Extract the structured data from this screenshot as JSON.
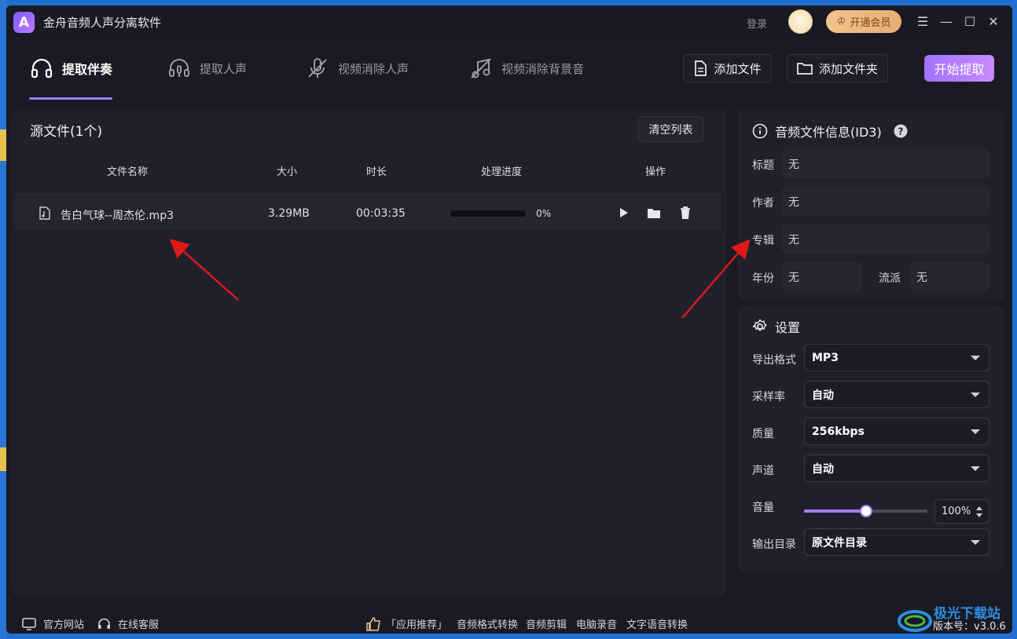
{
  "app": {
    "title": "金舟音频人声分离软件",
    "logo_letter": "A"
  },
  "titlebar": {
    "login": "登录",
    "vip": "开通会员"
  },
  "tabs": [
    {
      "label": "提取伴奏",
      "active": true
    },
    {
      "label": "提取人声",
      "active": false
    },
    {
      "label": "视频消除人声",
      "active": false
    },
    {
      "label": "视频消除背景音",
      "active": false
    }
  ],
  "actions": {
    "add_file": "添加文件",
    "add_folder": "添加文件夹",
    "start": "开始提取"
  },
  "source": {
    "title": "源文件(1个)",
    "clear": "清空列表",
    "columns": [
      "文件名称",
      "大小",
      "时长",
      "处理进度",
      "操作"
    ],
    "rows": [
      {
        "name": "告白气球--周杰伦.mp3",
        "size": "3.29MB",
        "duration": "00:03:35",
        "progress": 0,
        "progress_label": "0%"
      }
    ]
  },
  "id3": {
    "title": "音频文件信息(ID3)",
    "fields": {
      "title_label": "标题",
      "title_value": "无",
      "artist_label": "作者",
      "artist_value": "无",
      "album_label": "专辑",
      "album_value": "无",
      "year_label": "年份",
      "year_value": "无",
      "genre_label": "流派",
      "genre_value": "无"
    }
  },
  "settings": {
    "title": "设置",
    "format_label": "导出格式",
    "format_value": "MP3",
    "rate_label": "采样率",
    "rate_value": "自动",
    "quality_label": "质量",
    "quality_value": "256kbps",
    "channel_label": "声道",
    "channel_value": "自动",
    "volume_label": "音量",
    "volume_level": 1.0,
    "volume_text": "100%",
    "volume_slider_fraction": 0.5,
    "output_label": "输出目录",
    "output_value": "原文件目录"
  },
  "footer": {
    "website": "官方网站",
    "support": "在线客服",
    "recommend": "「应用推荐」",
    "links": [
      "音频格式转换",
      "音频剪辑",
      "电脑录音",
      "文字语音转换"
    ],
    "version": "版本号：v3.0.6"
  },
  "colors": {
    "accent": "#9b7bff",
    "bg": "#1a1a24",
    "panel": "#20202c",
    "vip": "#e7ad73"
  }
}
